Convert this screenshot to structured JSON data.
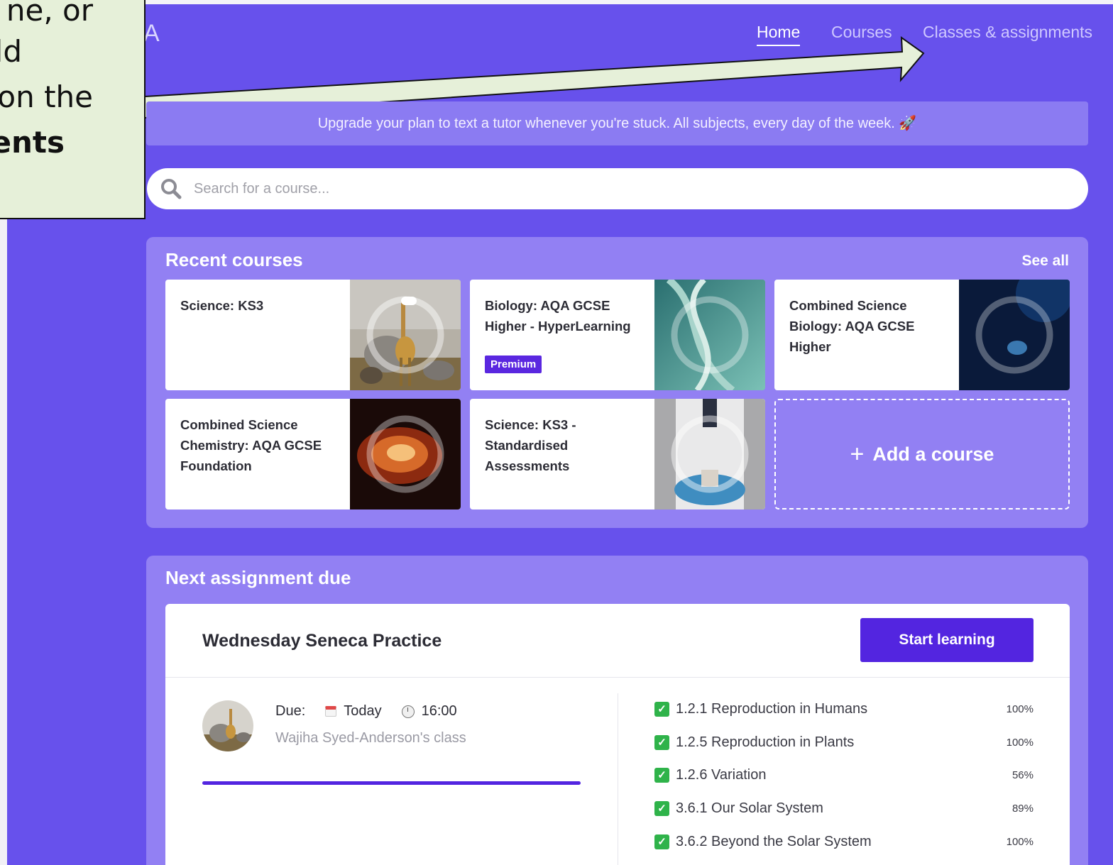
{
  "logo_fragment": "A",
  "nav": {
    "home": "Home",
    "courses": "Courses",
    "classes": "Classes & assignments"
  },
  "callout": {
    "lines": [
      "ne, or",
      "ld",
      "on the",
      "ents"
    ]
  },
  "banner": {
    "text": "Upgrade your plan to text a tutor whenever you're stuck. All subjects, every day of the week. 🚀"
  },
  "search": {
    "placeholder": "Search for a course..."
  },
  "recent_courses": {
    "title": "Recent courses",
    "see_all": "See all",
    "cards": [
      {
        "title": "Science: KS3",
        "image": "giraffe-elephant"
      },
      {
        "title": "Biology: AQA GCSE Higher - HyperLearning",
        "badge": "Premium",
        "image": "dna-helix"
      },
      {
        "title": "Combined Science Biology: AQA GCSE Higher",
        "image": "blue-fish"
      },
      {
        "title": "Combined Science Chemistry: AQA GCSE Foundation",
        "image": "fire-flame"
      },
      {
        "title": "Science: KS3 - Standardised Assessments",
        "image": "lab-scientist"
      }
    ],
    "add_label": "Add a course"
  },
  "next_assignment": {
    "title": "Next assignment due",
    "name": "Wednesday Seneca Practice",
    "start_label": "Start learning",
    "due_label": "Due:",
    "due_day": "Today",
    "due_time": "16:00",
    "class_name": "Wajiha Syed-Anderson's class",
    "progress": 1.0,
    "topics": [
      {
        "label": "1.2.1 Reproduction in Humans",
        "pct": "100%"
      },
      {
        "label": "1.2.5 Reproduction in Plants",
        "pct": "100%"
      },
      {
        "label": "1.2.6 Variation",
        "pct": "56%"
      },
      {
        "label": "3.6.1 Our Solar System",
        "pct": "89%"
      },
      {
        "label": "3.6.2 Beyond the Solar System",
        "pct": "100%"
      }
    ]
  },
  "colors": {
    "background": "#6751ec",
    "panel": "#9280f3",
    "accent": "#5325e0",
    "callout": "#e6f0d9"
  }
}
